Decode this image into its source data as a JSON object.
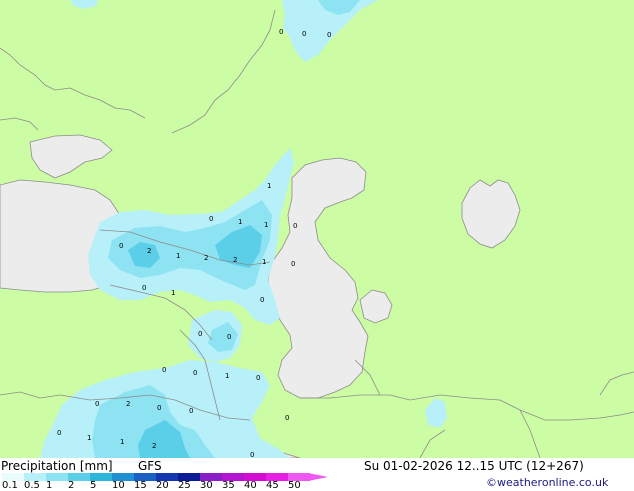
{
  "title": "Precipitation [mm]",
  "model": "GFS",
  "datetime": "Su 01-02-2026 12..15 UTC (12+267)",
  "credit": "©weatheronline.co.uk",
  "colors": {
    "land": "#ccfca4",
    "water": "#ececec",
    "border": "#8c8c8c",
    "precip_light": "#b7f0f9",
    "precip_mid": "#8ee3f3",
    "precip_heavy": "#5ccfe8"
  },
  "legend": {
    "ticks": [
      "0.1",
      "0.5",
      "1",
      "2",
      "5",
      "10",
      "15",
      "20",
      "25",
      "30",
      "35",
      "40",
      "45",
      "50"
    ],
    "colors": [
      "#e8fbfd",
      "#b7f0f9",
      "#8ee3f3",
      "#5ccfe8",
      "#2cb6dc",
      "#1e8fd0",
      "#1a5fc4",
      "#1436b0",
      "#0c1c96",
      "#8a1ec8",
      "#b414d2",
      "#d20cd2",
      "#e61ee6",
      "#f056f0"
    ]
  },
  "map_values": [
    "0",
    "0",
    "0",
    "1",
    "0",
    "1",
    "1",
    "0",
    "0",
    "2",
    "1",
    "2",
    "2",
    "1",
    "0",
    "0",
    "1",
    "0",
    "0",
    "0",
    "0",
    "0",
    "1",
    "0",
    "0",
    "2",
    "0",
    "0",
    "0",
    "0",
    "1",
    "1",
    "2",
    "0"
  ]
}
